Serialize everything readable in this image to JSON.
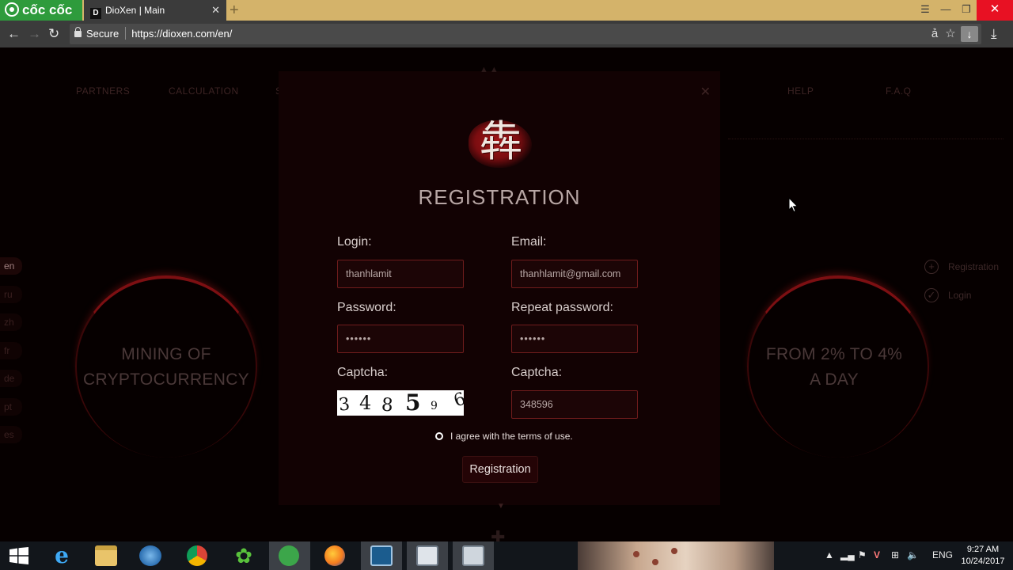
{
  "browser": {
    "brand": "cốc cốc",
    "tab": {
      "favicon": "D",
      "title": "DioXen | Main"
    },
    "address": {
      "secure_label": "Secure",
      "url": "https://dioxen.com/en/"
    },
    "window_controls": [
      "minimize",
      "restore",
      "close"
    ]
  },
  "site": {
    "nav": [
      "PARTNERS",
      "CALCULATION",
      "S",
      "HELP",
      "F.A.Q"
    ],
    "languages": [
      "en",
      "ru",
      "zh",
      "fr",
      "de",
      "pt",
      "es"
    ],
    "active_language": "en",
    "left_circle": [
      "MINING OF",
      "CRYPTOCURRENCY"
    ],
    "right_circle": [
      "FROM 2% TO 4%",
      "A DAY"
    ],
    "right_menu": [
      {
        "icon": "plus-icon",
        "label": "Registration"
      },
      {
        "icon": "check-icon",
        "label": "Login"
      }
    ]
  },
  "modal": {
    "logo_glyph": "犇",
    "title": "REGISTRATION",
    "fields": {
      "login_label": "Login:",
      "login_value": "thanhlamit",
      "email_label": "Email:",
      "email_value": "thanhlamit@gmail.com",
      "password_label": "Password:",
      "password_value": "••••••",
      "repeat_password_label": "Repeat password:",
      "repeat_password_value": "••••••",
      "captcha_label": "Captcha:",
      "captcha_image_text": [
        "3",
        "4",
        "8",
        "5",
        "9",
        "6"
      ],
      "captcha_label_2": "Captcha:",
      "captcha_value": "348596"
    },
    "agree_text": "I agree with the terms of use.",
    "submit_label": "Registration"
  },
  "taskbar": {
    "language": "ENG",
    "time": "9:27 AM",
    "date": "10/24/2017"
  }
}
